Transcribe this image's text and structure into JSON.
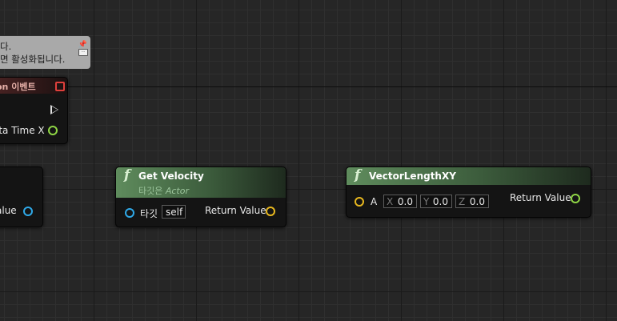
{
  "comment": {
    "line1": "다.",
    "line2": "면 활성화됩니다."
  },
  "event_node": {
    "title": "on 이벤트",
    "pin_label": "lta Time X"
  },
  "partial_node": {
    "pin_label": "alue"
  },
  "get_velocity": {
    "title": "Get Velocity",
    "subtitle_prefix": "타깃은 ",
    "subtitle_type": "Actor",
    "target_label": "타깃",
    "target_value": "self",
    "return_label": "Return Value"
  },
  "vector_length": {
    "title": "VectorLengthXY",
    "input_label": "A",
    "x_axis": "X",
    "x_value": "0.0",
    "y_axis": "Y",
    "y_value": "0.0",
    "z_axis": "Z",
    "z_value": "0.0",
    "return_label": "Return Value"
  },
  "colors": {
    "background": "#262626",
    "function_header": "#5f8c5d",
    "object_pin": "#2fa9e8",
    "vector_pin": "#e8b81f",
    "float_pin": "#8fd645",
    "event_close": "#e0403c"
  }
}
